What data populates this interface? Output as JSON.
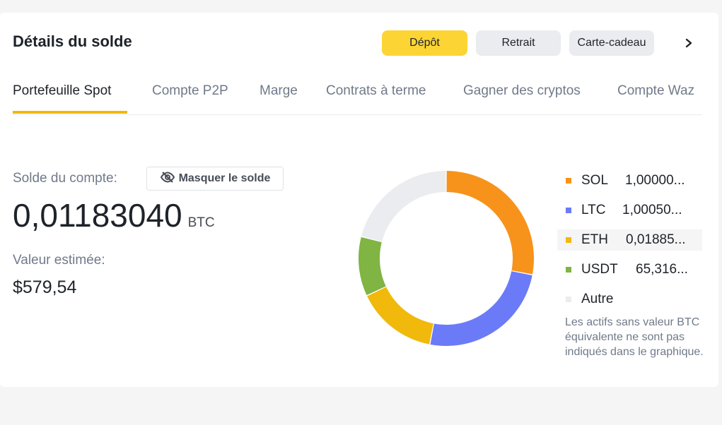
{
  "header": {
    "title": "Détails du solde",
    "deposit_label": "Dépôt",
    "withdraw_label": "Retrait",
    "gift_label": "Carte-cadeau"
  },
  "tabs": [
    {
      "label": "Portefeuille Spot",
      "active": true
    },
    {
      "label": "Compte P2P"
    },
    {
      "label": "Marge"
    },
    {
      "label": "Contrats à terme"
    },
    {
      "label": "Gagner des cryptos"
    },
    {
      "label": "Compte Waz"
    }
  ],
  "account": {
    "balance_label": "Solde du compte:",
    "hide_label": "Masquer le solde",
    "balance_value": "0,01183040",
    "balance_unit": "BTC",
    "estimated_label": "Valeur estimée:",
    "estimated_value": "$579,54"
  },
  "colors": {
    "accent": "#f0b90b",
    "sol": "#f7931a",
    "ltc": "#6b7bf7",
    "eth": "#f0b90b",
    "usdt": "#80b443",
    "other": "#eaecef"
  },
  "legend": [
    {
      "name": "SOL",
      "value": "1,00000...",
      "color": "#f7931a"
    },
    {
      "name": "LTC",
      "value": "1,00050...",
      "color": "#6b7bf7"
    },
    {
      "name": "ETH",
      "value": "0,01885...",
      "color": "#f0b90b"
    },
    {
      "name": "USDT",
      "value": "65,316...",
      "color": "#80b443"
    },
    {
      "name": "Autre",
      "value": "",
      "color": "#eaecef"
    }
  ],
  "footnote": "Les actifs sans valeur BTC équivalente ne sont pas indiqués dans le graphique.",
  "chart_data": {
    "type": "pie",
    "categories": [
      "SOL",
      "LTC",
      "ETH",
      "USDT",
      "Autre"
    ],
    "values": [
      28,
      25,
      15,
      11,
      21
    ]
  },
  "icons": {
    "hide": "eye-slash-icon",
    "next": "chevron-right-icon"
  }
}
